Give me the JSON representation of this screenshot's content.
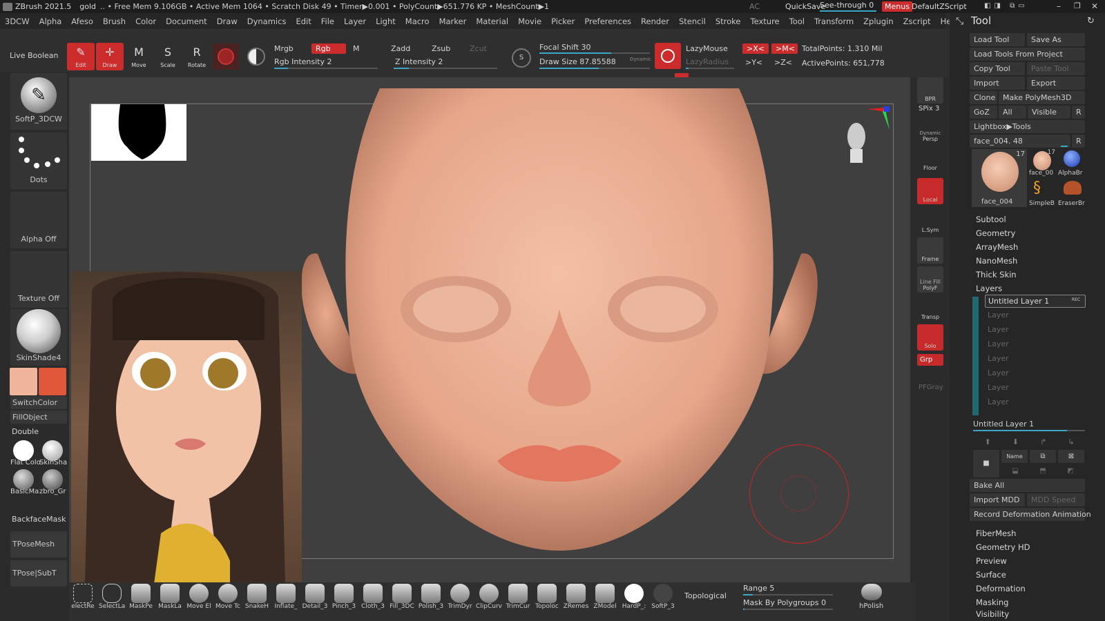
{
  "titlebar": {
    "app": "ZBrush 2021.5",
    "project": "gold",
    "status": ".. • Free Mem 9.106GB • Active Mem 1064 • Scratch Disk 49 • Timer▶0.001 • PolyCount▶651.776 KP • MeshCount▶1",
    "ac": "AC",
    "quicksave": "QuickSave",
    "see_through": "See-through  0",
    "menus": "Menus",
    "script": "DefaultZScript"
  },
  "menu": [
    "3DCW",
    "Alpha",
    "Afeso",
    "Brush",
    "Color",
    "Document",
    "Draw",
    "Dynamics",
    "Edit",
    "File",
    "Layer",
    "Light",
    "Macro",
    "Marker",
    "Material",
    "Movie",
    "Picker",
    "Preferences",
    "Render",
    "Stencil",
    "Stroke",
    "Texture",
    "Tool",
    "Transform",
    "Zplugin",
    "Zscript",
    "Help"
  ],
  "topshelf": {
    "live_boolean": "Live Boolean",
    "edit": "Edit",
    "draw": "Draw",
    "move": "Move",
    "scale": "Scale",
    "rotate": "Rotate",
    "mrgb": "Mrgb",
    "rgb": "Rgb",
    "m": "M",
    "rgb_intensity": "Rgb Intensity 2",
    "zadd": "Zadd",
    "zsub": "Zsub",
    "zcut": "Zcut",
    "z_intensity": "Z Intensity 2",
    "focal_shift": "Focal Shift 30",
    "draw_size": "Draw Size 87.85588",
    "dynamic": "Dynamic",
    "lazymouse": "LazyMouse",
    "lazyradius": "LazyRadius",
    "x_sym": ">X<",
    "m_sym": ">M<",
    "y_sym": ">Y<",
    "z_sym": ">Z<",
    "total_points": "TotalPoints: 1.310 Mil",
    "active_points": "ActivePoints: 651,778"
  },
  "leftshelf": {
    "brush": "SoftP_3DCW",
    "stroke": "Dots",
    "alpha": "Alpha Off",
    "texture": "Texture Off",
    "material": "SkinShade4",
    "switch_color": "SwitchColor",
    "fill_object": "FillObject",
    "double": "Double",
    "mat1": "Flat Colo",
    "mat2": "SkinSha",
    "mat3": "BasicMa",
    "mat4": "zbro_Gr",
    "backface_mask": "BackfaceMask",
    "tpose_mesh": "TPoseMesh",
    "tpose_subt": "TPose|SubT",
    "main_color": "#f0b59a",
    "secondary_color": "#e0583a"
  },
  "rightshelf": {
    "bpr": "BPR",
    "spix": "SPix 3",
    "persp": "Persp",
    "dynamic": "Dynamic",
    "floor": "Floor",
    "local": "Local",
    "lsym": "L.Sym",
    "frame": "Frame",
    "line_fill": "Line Fill",
    "polyf": "PolyF",
    "transp": "Transp",
    "solo": "Solo",
    "grp": "Grp",
    "pfgray": "PFGray"
  },
  "bottomshelf": {
    "brushes": [
      "electRe",
      "SelectLa",
      "MaskPe",
      "MaskLa",
      "Move El",
      "Move Tc",
      "SnakeH",
      "Inflate_",
      "Detail_3",
      "Pinch_3",
      "Cloth_3",
      "Fill_3DC",
      "Polish_3",
      "TrimDyr",
      "ClipCurv",
      "TrimCur",
      "Topoloc",
      "ZRemes",
      "ZModel",
      "HardP_:",
      "SoftP_3"
    ],
    "topological": "Topological",
    "range": "Range 5",
    "mask_by_polygroups": "Mask By Polygroups 0",
    "hpolish": "hPolish"
  },
  "tool": {
    "title": "Tool",
    "load_tool": "Load Tool",
    "save_as": "Save As",
    "load_from_project": "Load Tools From Project",
    "copy_tool": "Copy Tool",
    "paste_tool": "Paste Tool",
    "import": "Import",
    "export": "Export",
    "clone": "Clone",
    "make_polymesh": "Make PolyMesh3D",
    "goz": "GoZ",
    "all": "All",
    "visible": "Visible",
    "r": "R",
    "lightbox_tools": "Lightbox▶Tools",
    "current_tool": "face_004. 48",
    "thumbs": {
      "main": "face_004",
      "main_count": "17",
      "t1": "face_00",
      "t1_count": "17",
      "t2": "AlphaBr",
      "t3": "SimpleB",
      "t4": "EraserBr"
    },
    "sections": [
      "Subtool",
      "Geometry",
      "ArrayMesh",
      "NanoMesh",
      "Thick Skin"
    ],
    "layers_title": "Layers",
    "active_layer": "Untitled Layer 1",
    "rec": "REC",
    "empty_layers": [
      "Layer",
      "Layer",
      "Layer",
      "Layer",
      "Layer",
      "Layer",
      "Layer"
    ],
    "layer_name_slider": "Untitled Layer 1",
    "name_btn": "Name",
    "bake_all": "Bake All",
    "import_mdd": "Import MDD",
    "mdd_speed": "MDD Speed",
    "record_deformation": "Record Deformation Animation",
    "sections2": [
      "FiberMesh",
      "Geometry HD",
      "Preview",
      "Surface",
      "Deformation",
      "Masking",
      "Visibility"
    ]
  }
}
